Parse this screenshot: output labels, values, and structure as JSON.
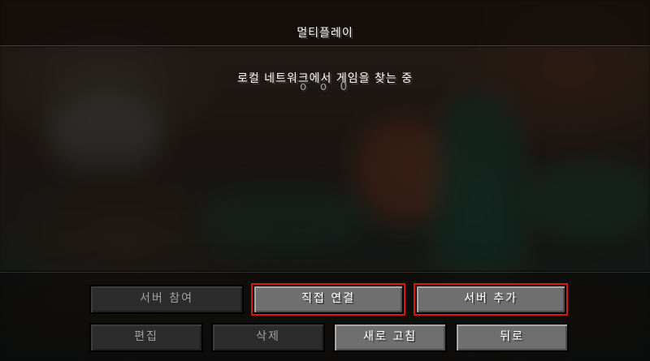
{
  "screen": {
    "title": "멀티플레이",
    "scan_message": "로컬 네트워크에서 게임을 찾는 중",
    "scan_indicator": "o o O"
  },
  "buttons": {
    "join_server": {
      "label": "서버 참여",
      "enabled": false
    },
    "direct_connect": {
      "label": "직접 연결",
      "enabled": true,
      "highlighted": true
    },
    "add_server": {
      "label": "서버 추가",
      "enabled": true,
      "highlighted": true
    },
    "edit": {
      "label": "편집",
      "enabled": false
    },
    "delete": {
      "label": "삭제",
      "enabled": false
    },
    "refresh": {
      "label": "새로 고침",
      "enabled": true
    },
    "back": {
      "label": "뒤로",
      "enabled": true
    }
  },
  "colors": {
    "highlight_border": "#e01414",
    "button_face": "#6f6f6f",
    "button_disabled": "#2c2c2c"
  }
}
